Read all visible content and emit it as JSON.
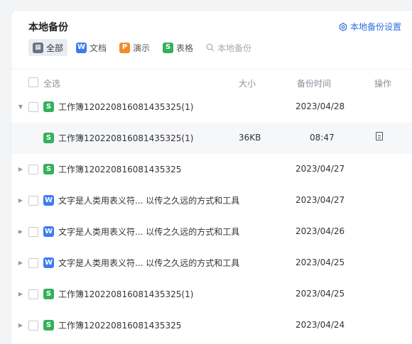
{
  "title": "本地备份",
  "settings_label": "本地备份设置",
  "filters": [
    {
      "label": "全部",
      "icon": "grid-icon",
      "glyph": "▦",
      "active": true,
      "type": "all"
    },
    {
      "label": "文档",
      "icon": "word-icon",
      "glyph": "W",
      "active": false,
      "type": "w"
    },
    {
      "label": "演示",
      "icon": "presentation-icon",
      "glyph": "P",
      "active": false,
      "type": "p"
    },
    {
      "label": "表格",
      "icon": "spreadsheet-icon",
      "glyph": "S",
      "active": false,
      "type": "s"
    }
  ],
  "search_placeholder": "本地备份",
  "table": {
    "col_select_all": "全选",
    "col_size": "大小",
    "col_time": "备份时间",
    "col_action": "操作"
  },
  "rows": [
    {
      "kind": "group",
      "expanded": true,
      "type": "s",
      "glyph": "S",
      "name": "工作簿120220816081435325(1)",
      "size": "",
      "time": "2023/04/28"
    },
    {
      "kind": "child",
      "type": "s",
      "glyph": "S",
      "name": "工作簿120220816081435325(1)",
      "size": "36KB",
      "time": "08:47"
    },
    {
      "kind": "group",
      "expanded": false,
      "type": "s",
      "glyph": "S",
      "name": "工作簿120220816081435325",
      "size": "",
      "time": "2023/04/27"
    },
    {
      "kind": "group",
      "expanded": false,
      "type": "w",
      "glyph": "W",
      "name": "文字是人类用表义符... 以传之久远的方式和工具",
      "size": "",
      "time": "2023/04/27"
    },
    {
      "kind": "group",
      "expanded": false,
      "type": "w",
      "glyph": "W",
      "name": "文字是人类用表义符... 以传之久远的方式和工具",
      "size": "",
      "time": "2023/04/26"
    },
    {
      "kind": "group",
      "expanded": false,
      "type": "w",
      "glyph": "W",
      "name": "文字是人类用表义符... 以传之久远的方式和工具",
      "size": "",
      "time": "2023/04/25"
    },
    {
      "kind": "group",
      "expanded": false,
      "type": "s",
      "glyph": "S",
      "name": "工作簿120220816081435325(1)",
      "size": "",
      "time": "2023/04/25"
    },
    {
      "kind": "group",
      "expanded": false,
      "type": "s",
      "glyph": "S",
      "name": "工作簿120220816081435325",
      "size": "",
      "time": "2023/04/24"
    }
  ]
}
